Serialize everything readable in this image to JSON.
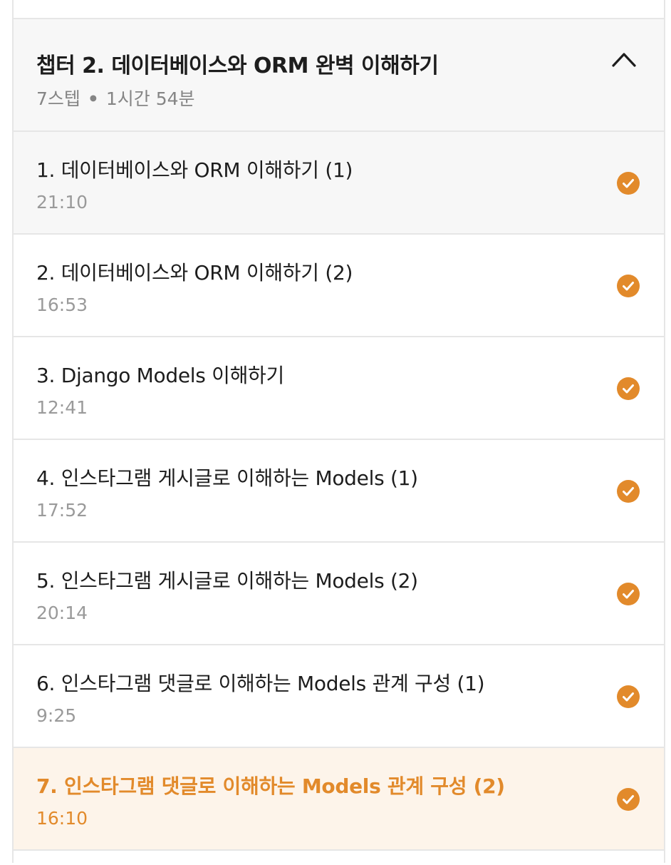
{
  "chapter": {
    "title": "챕터 2. 데이터베이스와 ORM 완벽 이해하기",
    "steps": "7스텝",
    "separator": "•",
    "duration": "1시간 54분",
    "toggle_icon": "chevron-up-icon"
  },
  "accent_color": "#e28a2b",
  "lessons": [
    {
      "title": "1. 데이터베이스와 ORM 이해하기 (1)",
      "time": "21:10",
      "completed": true
    },
    {
      "title": "2. 데이터베이스와 ORM 이해하기 (2)",
      "time": "16:53",
      "completed": true
    },
    {
      "title": "3. Django Models 이해하기",
      "time": "12:41",
      "completed": true
    },
    {
      "title": "4. 인스타그램 게시글로 이해하는 Models (1)",
      "time": "17:52",
      "completed": true
    },
    {
      "title": "5. 인스타그램 게시글로 이해하는 Models (2)",
      "time": "20:14",
      "completed": true
    },
    {
      "title": "6. 인스타그램 댓글로 이해하는 Models 관계 구성 (1)",
      "time": "9:25",
      "completed": true
    },
    {
      "title": "7. 인스타그램 댓글로 이해하는 Models 관계 구성 (2)",
      "time": "16:10",
      "completed": true,
      "active": true
    }
  ]
}
